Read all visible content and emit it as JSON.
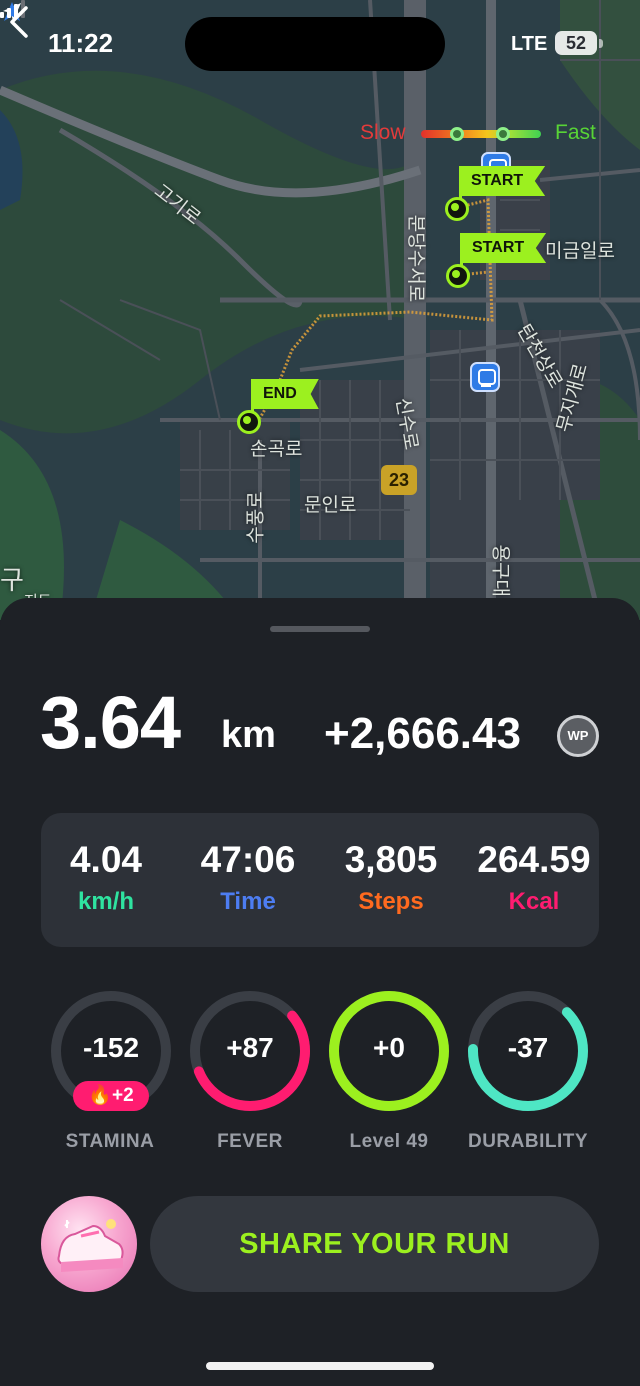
{
  "status_bar": {
    "time": "11:22",
    "network": "LTE",
    "battery": "52"
  },
  "map": {
    "legend": {
      "slow": "Slow",
      "fast": "Fast"
    },
    "markers": {
      "start_1": "START",
      "start_2": "START",
      "end": "END"
    },
    "labels": {
      "goki_ro": "고기로",
      "bundang_suseo_ro": "분당수서로",
      "migeum_il_ro": "미금일로",
      "tancheon_sang_ro": "탄천상로",
      "mujigae_ro": "무지개로",
      "songok_ro": "손곡로",
      "sinsu_ro": "신수로",
      "munin_ro": "문인로",
      "sujeong_ro": "수풍로",
      "yonggu_dae_ro": "용구대로",
      "edge_gu": "구",
      "edge_map": "지도"
    },
    "route_number": "23"
  },
  "summary": {
    "distance_value": "3.64",
    "distance_unit": "km",
    "points": "+2,666.43",
    "points_badge": "WP"
  },
  "stats": [
    {
      "value": "4.04",
      "label": "km/h",
      "color": "#2fe3a0"
    },
    {
      "value": "47:06",
      "label": "Time",
      "color": "#4d7df2"
    },
    {
      "value": "3,805",
      "label": "Steps",
      "color": "#ff6a1f"
    },
    {
      "value": "264.59",
      "label": "Kcal",
      "color": "#ff1c70"
    }
  ],
  "gauges": [
    {
      "value": "-152",
      "label": "STAMINA",
      "fill": 0,
      "color": "#ff1c70",
      "boost": "+2"
    },
    {
      "value": "+87",
      "label": "FEVER",
      "fill": 0.55,
      "color": "#ff1c70"
    },
    {
      "value": "+0",
      "label": "Level 49",
      "fill": 1.0,
      "color": "#9cf01f"
    },
    {
      "value": "-37",
      "label": "DURABILITY",
      "fill": 0.63,
      "color": "#4ee6c4"
    }
  ],
  "share_button": "SHARE YOUR RUN"
}
